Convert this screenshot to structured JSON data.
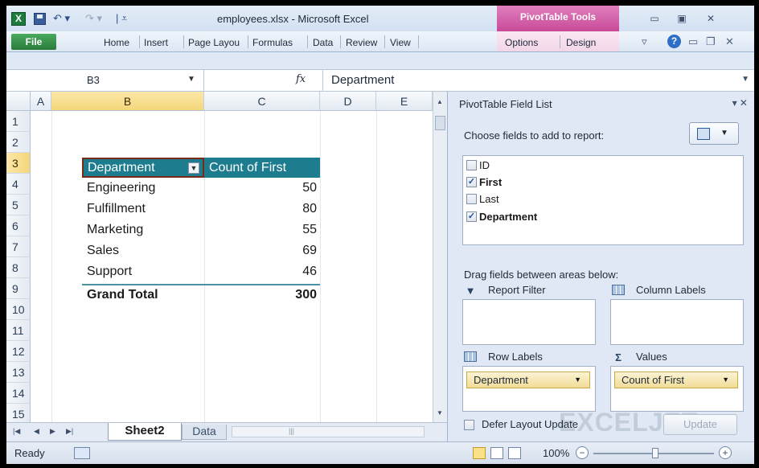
{
  "window": {
    "doc_title": "employees.xlsx - Microsoft Excel",
    "context_tab_title": "PivotTable Tools",
    "logo_letter": "X"
  },
  "ribbon": {
    "file_tab": "File",
    "tabs": [
      "Home",
      "Insert",
      "Page Layou",
      "Formulas",
      "Data",
      "Review",
      "View"
    ],
    "context_tabs": [
      "Options",
      "Design"
    ]
  },
  "formula_bar": {
    "name_box": "B3",
    "fx_label": "fx",
    "value": "Department"
  },
  "sheet": {
    "columns": [
      "A",
      "B",
      "C",
      "D",
      "E"
    ],
    "rows": [
      "1",
      "2",
      "3",
      "4",
      "5",
      "6",
      "7",
      "8",
      "9",
      "10",
      "11",
      "12",
      "13",
      "14",
      "15"
    ],
    "selected_column": "B",
    "selected_row": "3"
  },
  "pivot": {
    "row_header": "Department",
    "value_header": "Count of First",
    "rows": [
      {
        "label": "Engineering",
        "value": "50"
      },
      {
        "label": "Fulfillment",
        "value": "80"
      },
      {
        "label": "Marketing",
        "value": "55"
      },
      {
        "label": "Sales",
        "value": "69"
      },
      {
        "label": "Support",
        "value": "46"
      }
    ],
    "total_label": "Grand Total",
    "total_value": "300"
  },
  "sheet_tabs": {
    "active": "Sheet2",
    "other": "Data"
  },
  "status": {
    "ready": "Ready",
    "zoom": "100%",
    "zoom_minus": "−",
    "zoom_plus": "+"
  },
  "field_list": {
    "title": "PivotTable Field List",
    "choose_label": "Choose fields to add to report:",
    "fields": [
      {
        "name": "ID",
        "checked": false
      },
      {
        "name": "First",
        "checked": true
      },
      {
        "name": "Last",
        "checked": false
      },
      {
        "name": "Department",
        "checked": true
      }
    ],
    "drag_label": "Drag fields between areas below:",
    "report_filter": "Report Filter",
    "column_labels": "Column Labels",
    "row_labels": "Row Labels",
    "values": "Values",
    "row_field": "Department",
    "value_field": "Count of First",
    "defer_label": "Defer Layout Update",
    "update_button": "Update"
  },
  "watermark": {
    "text": "EXCELJET"
  },
  "colors": {
    "pivot_header": "#1e7c8f",
    "pivot_tools": "#c84b98",
    "file_tab": "#2b7b3c",
    "selected_header": "#f5d67a"
  }
}
